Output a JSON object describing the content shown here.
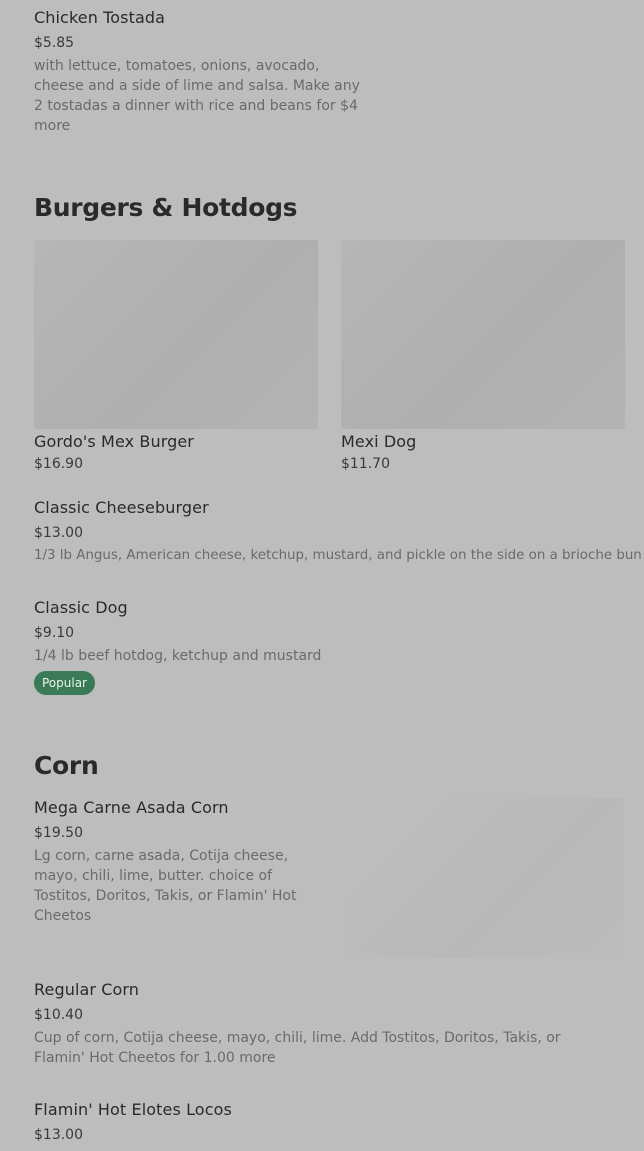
{
  "tostada": {
    "name": "Chicken Tostada",
    "price": "$5.85",
    "desc": "with lettuce, tomatoes, onions, avocado, cheese and a side of lime and salsa. Make any 2 tostadas a dinner with rice and beans for $4 more"
  },
  "burgers": {
    "title": "Burgers & Hotdogs",
    "featured": [
      {
        "name": "Gordo's Mex Burger",
        "price": "$16.90"
      },
      {
        "name": "Mexi Dog",
        "price": "$11.70"
      }
    ],
    "classic_cheeseburger": {
      "name": "Classic Cheeseburger",
      "price": "$13.00",
      "desc": "1/3 lb Angus, American cheese, ketchup, mustard, and pickle on the side on a brioche bun"
    },
    "classic_dog": {
      "name": "Classic Dog",
      "price": "$9.10",
      "desc": "1/4 lb beef hotdog, ketchup and mustard",
      "badge": "Popular"
    }
  },
  "corn": {
    "title": "Corn",
    "mega": {
      "name": "Mega Carne Asada Corn",
      "price": "$19.50",
      "desc": "Lg corn, carne asada, Cotija cheese, mayo, chili, lime, butter. choice of Tostitos, Doritos, Takis, or Flamin' Hot Cheetos"
    },
    "regular": {
      "name": "Regular Corn",
      "price": "$10.40",
      "desc": "Cup of corn, Cotija cheese, mayo, chili, lime. Add Tostitos, Doritos, Takis, or Flamin' Hot Cheetos for 1.00 more"
    },
    "flamin": {
      "name": "Flamin' Hot Elotes Locos",
      "price": "$13.00"
    }
  },
  "colors": {
    "background": "#bdbdbd",
    "badge": "#3b7a57"
  }
}
